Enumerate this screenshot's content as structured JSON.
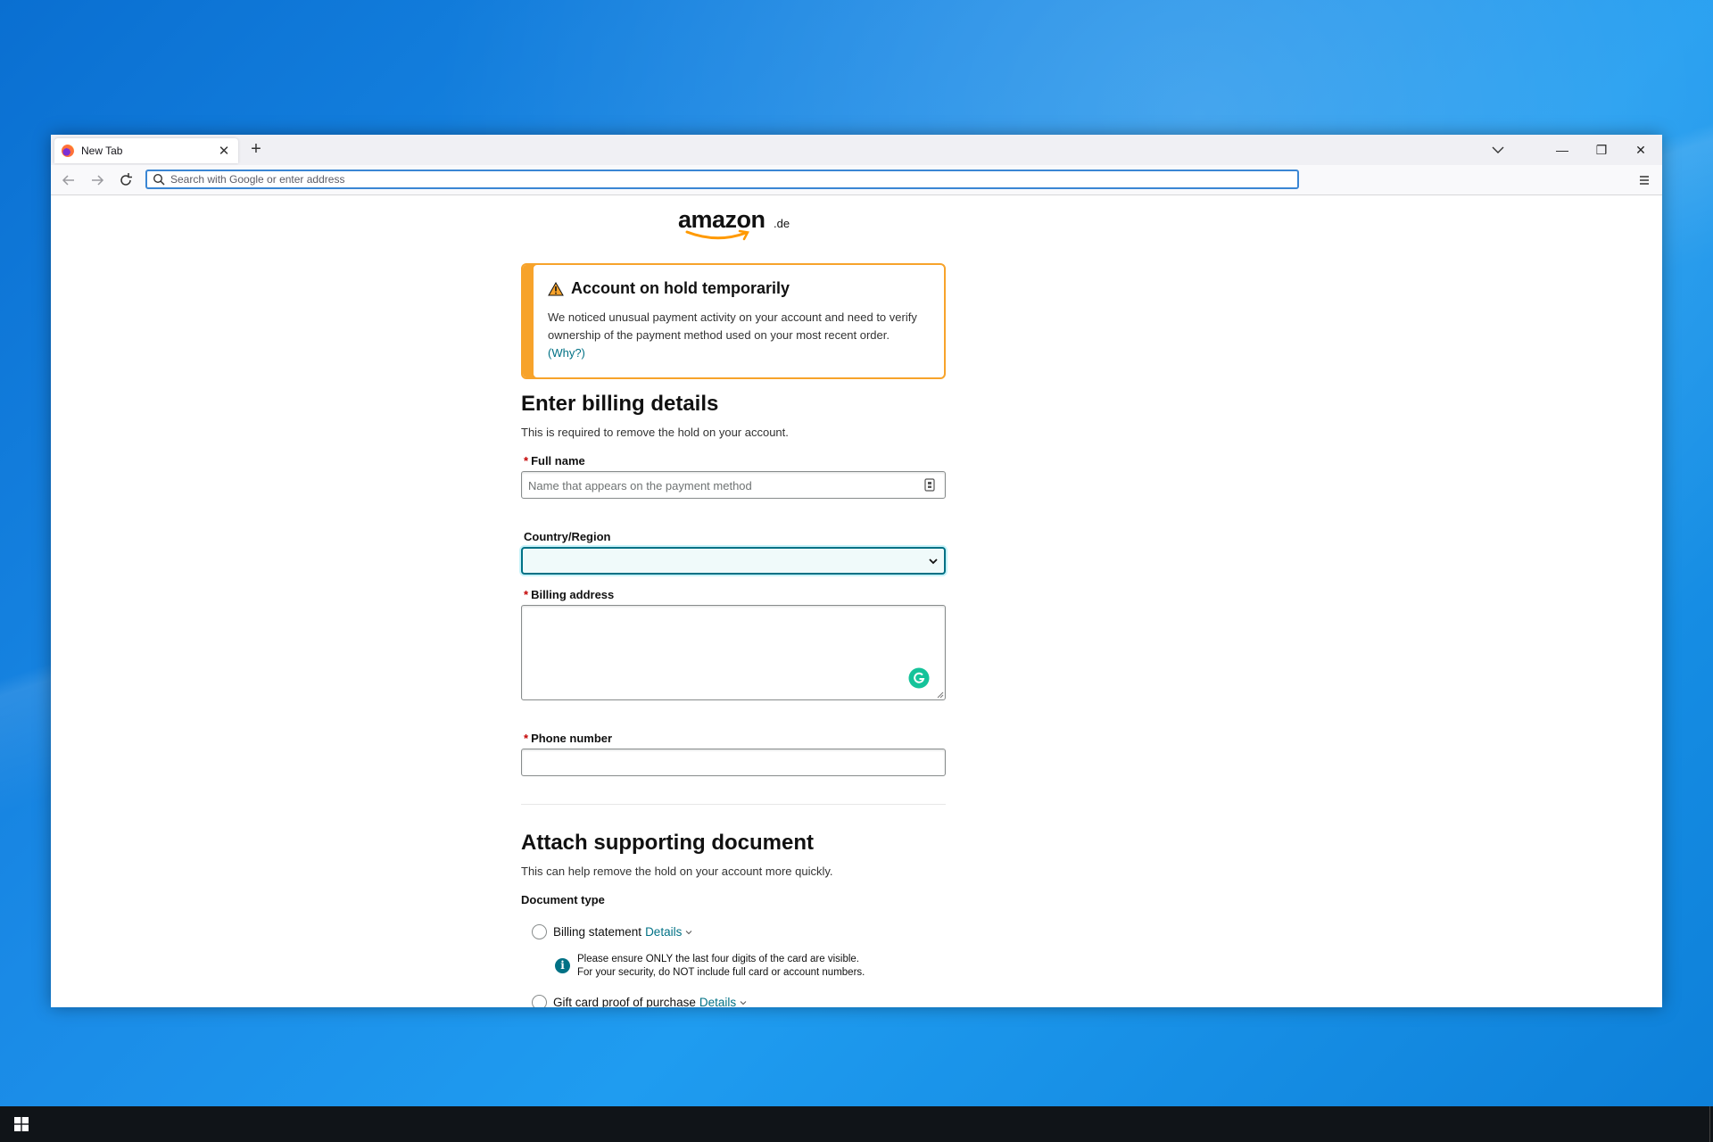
{
  "browser": {
    "tab_title": "New Tab",
    "tab_close": "✕",
    "new_tab": "+",
    "url_placeholder": "Search with Google or enter address",
    "controls": {
      "minimize": "—",
      "restore": "❐",
      "close": "✕"
    }
  },
  "page": {
    "logo": {
      "word": "amazon",
      "tld": ".de"
    },
    "alert": {
      "title": "Account on hold temporarily",
      "body": "We noticed unusual payment activity on your account and need to verify ownership of the payment method used on your most recent order. ",
      "link": "(Why?)"
    },
    "billing": {
      "heading": "Enter billing details",
      "subtext": "This is required to remove the hold on your account.",
      "full_name_label": "Full name",
      "full_name_placeholder": "Name that appears on the payment method",
      "country_label": "Country/Region",
      "address_label": "Billing address",
      "phone_label": "Phone number",
      "required_mark": "*"
    },
    "document": {
      "heading": "Attach supporting document",
      "subtext": "This can help remove the hold on your account more quickly.",
      "type_label": "Document type",
      "options": [
        {
          "label": "Billing statement",
          "details": "Details"
        },
        {
          "label": "Gift card proof of purchase",
          "details": "Details"
        }
      ],
      "info_line1": "Please ensure ONLY the last four digits of the card are visible.",
      "info_line2": "For your security, do NOT include full card or account numbers."
    }
  },
  "colors": {
    "accent": "#007185",
    "alert_border": "#f7a32b",
    "required": "#c40000",
    "grammarly": "#15c39a"
  }
}
